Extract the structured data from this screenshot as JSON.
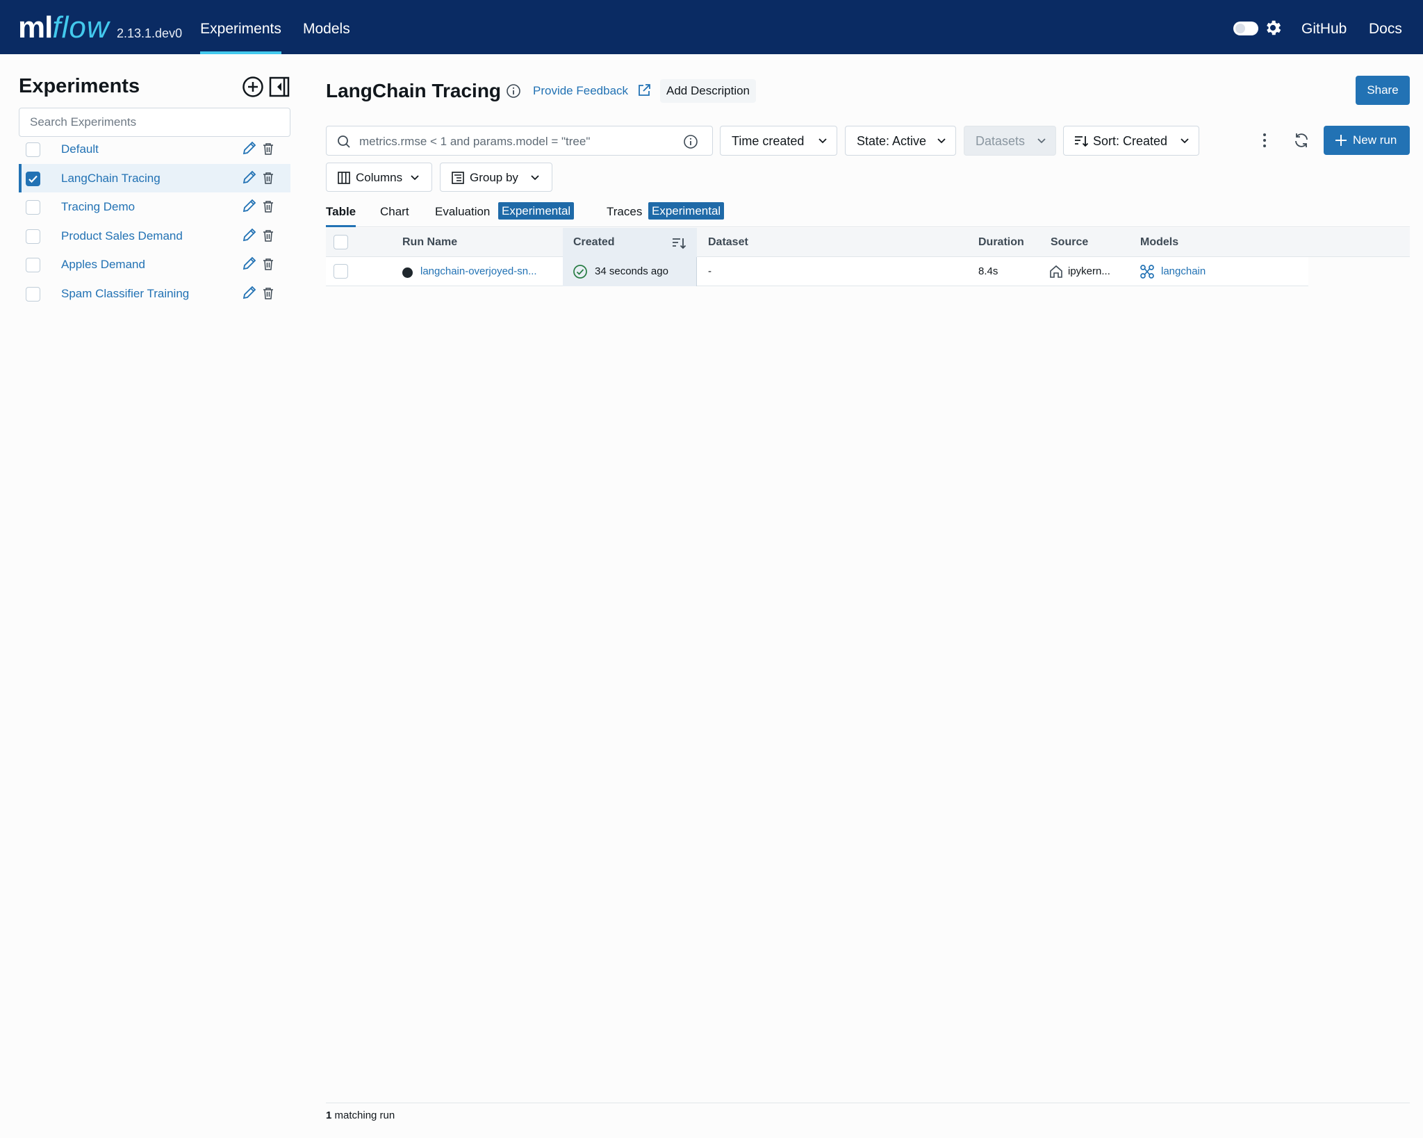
{
  "header": {
    "logo_ml": "ml",
    "logo_flow": "flow",
    "version": "2.13.1.dev0",
    "nav": [
      "Experiments",
      "Models"
    ],
    "active_nav": "Experiments",
    "github": "GitHub",
    "docs": "Docs"
  },
  "sidebar": {
    "title": "Experiments",
    "search_placeholder": "Search Experiments",
    "items": [
      {
        "label": "Default",
        "checked": false
      },
      {
        "label": "LangChain Tracing",
        "checked": true
      },
      {
        "label": "Tracing Demo",
        "checked": false
      },
      {
        "label": "Product Sales Demand",
        "checked": false
      },
      {
        "label": "Apples Demand",
        "checked": false
      },
      {
        "label": "Spam Classifier Training",
        "checked": false
      }
    ]
  },
  "main": {
    "title": "LangChain Tracing",
    "feedback": "Provide Feedback",
    "add_description": "Add Description",
    "share": "Share",
    "search_placeholder": "metrics.rmse < 1 and params.model = \"tree\"",
    "filters": {
      "time": "Time created",
      "state": "State: Active",
      "datasets": "Datasets",
      "sort": "Sort: Created"
    },
    "new_run": "New run",
    "columns": "Columns",
    "group_by": "Group by",
    "tabs": [
      {
        "label": "Table",
        "active": true
      },
      {
        "label": "Chart"
      },
      {
        "label": "Evaluation",
        "badge": "Experimental"
      },
      {
        "label": "Traces",
        "badge": "Experimental"
      }
    ],
    "table": {
      "headers": [
        "Run Name",
        "Created",
        "Dataset",
        "Duration",
        "Source",
        "Models"
      ],
      "rows": [
        {
          "run_name": "langchain-overjoyed-sn...",
          "created": "34 seconds ago",
          "dataset": "-",
          "duration": "8.4s",
          "source": "ipykern...",
          "models": "langchain"
        }
      ]
    },
    "footer_count": "1",
    "footer_text": "matching run"
  },
  "colors": {
    "header_bg": "#0a2b63",
    "accent": "#2272b4",
    "logo_flow": "#43c9ed"
  }
}
